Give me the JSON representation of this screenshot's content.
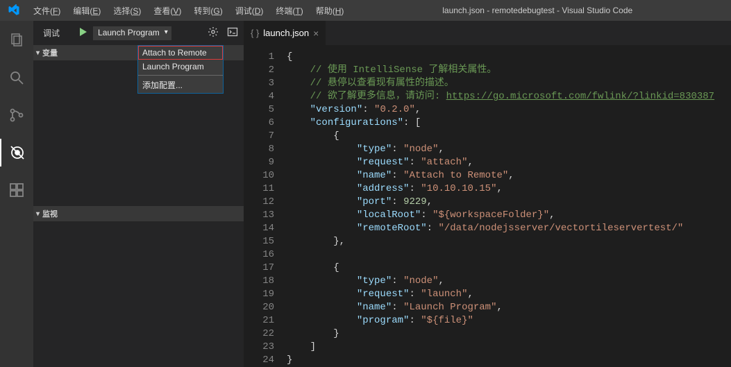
{
  "titlebar": {
    "menus": [
      "文件(F)",
      "编辑(E)",
      "选择(S)",
      "查看(V)",
      "转到(G)",
      "调试(D)",
      "终端(T)",
      "帮助(H)"
    ],
    "menus_underline": [
      "F",
      "E",
      "S",
      "V",
      "G",
      "D",
      "T",
      "H"
    ],
    "title": "launch.json - remotedebugtest - Visual Studio Code"
  },
  "activitybar": {
    "icons": [
      "files",
      "search",
      "source-control",
      "debug",
      "extensions"
    ],
    "active": "debug"
  },
  "sidebar": {
    "label": "调试",
    "config_selected": "Launch Program",
    "dropdown": {
      "items": [
        "Attach to Remote",
        "Launch Program"
      ],
      "add_config": "添加配置..."
    },
    "sections": {
      "variables": "变量",
      "watch": "监视"
    }
  },
  "tabs": {
    "file": "launch.json"
  },
  "code": {
    "lines": [
      {
        "n": 1,
        "segs": [
          {
            "t": "{",
            "c": "c-punct"
          }
        ]
      },
      {
        "n": 2,
        "indent": 4,
        "segs": [
          {
            "t": "// 使用 IntelliSense 了解相关属性。",
            "c": "c-comment"
          }
        ]
      },
      {
        "n": 3,
        "indent": 4,
        "segs": [
          {
            "t": "// 悬停以查看现有属性的描述。",
            "c": "c-comment"
          }
        ]
      },
      {
        "n": 4,
        "indent": 4,
        "segs": [
          {
            "t": "// 欲了解更多信息，请访问: ",
            "c": "c-comment"
          },
          {
            "t": "https://go.microsoft.com/fwlink/?linkid=830387",
            "c": "c-url"
          }
        ]
      },
      {
        "n": 5,
        "indent": 4,
        "segs": [
          {
            "t": "\"version\"",
            "c": "c-key"
          },
          {
            "t": ": ",
            "c": "c-punct"
          },
          {
            "t": "\"0.2.0\"",
            "c": "c-str"
          },
          {
            "t": ",",
            "c": "c-punct"
          }
        ]
      },
      {
        "n": 6,
        "indent": 4,
        "segs": [
          {
            "t": "\"configurations\"",
            "c": "c-key"
          },
          {
            "t": ": [",
            "c": "c-punct"
          }
        ]
      },
      {
        "n": 7,
        "indent": 8,
        "segs": [
          {
            "t": "{",
            "c": "c-punct"
          }
        ]
      },
      {
        "n": 8,
        "indent": 12,
        "segs": [
          {
            "t": "\"type\"",
            "c": "c-key"
          },
          {
            "t": ": ",
            "c": "c-punct"
          },
          {
            "t": "\"node\"",
            "c": "c-str"
          },
          {
            "t": ",",
            "c": "c-punct"
          }
        ]
      },
      {
        "n": 9,
        "indent": 12,
        "segs": [
          {
            "t": "\"request\"",
            "c": "c-key"
          },
          {
            "t": ": ",
            "c": "c-punct"
          },
          {
            "t": "\"attach\"",
            "c": "c-str"
          },
          {
            "t": ",",
            "c": "c-punct"
          }
        ]
      },
      {
        "n": 10,
        "indent": 12,
        "segs": [
          {
            "t": "\"name\"",
            "c": "c-key"
          },
          {
            "t": ": ",
            "c": "c-punct"
          },
          {
            "t": "\"Attach to Remote\"",
            "c": "c-str"
          },
          {
            "t": ",",
            "c": "c-punct"
          }
        ]
      },
      {
        "n": 11,
        "indent": 12,
        "segs": [
          {
            "t": "\"address\"",
            "c": "c-key"
          },
          {
            "t": ": ",
            "c": "c-punct"
          },
          {
            "t": "\"10.10.10.15\"",
            "c": "c-str"
          },
          {
            "t": ",",
            "c": "c-punct"
          }
        ]
      },
      {
        "n": 12,
        "indent": 12,
        "segs": [
          {
            "t": "\"port\"",
            "c": "c-key"
          },
          {
            "t": ": ",
            "c": "c-punct"
          },
          {
            "t": "9229",
            "c": "c-num"
          },
          {
            "t": ",",
            "c": "c-punct"
          }
        ]
      },
      {
        "n": 13,
        "indent": 12,
        "segs": [
          {
            "t": "\"localRoot\"",
            "c": "c-key"
          },
          {
            "t": ": ",
            "c": "c-punct"
          },
          {
            "t": "\"${workspaceFolder}\"",
            "c": "c-str"
          },
          {
            "t": ",",
            "c": "c-punct"
          }
        ]
      },
      {
        "n": 14,
        "indent": 12,
        "segs": [
          {
            "t": "\"remoteRoot\"",
            "c": "c-key"
          },
          {
            "t": ": ",
            "c": "c-punct"
          },
          {
            "t": "\"/data/nodejsserver/vectortileservertest/\"",
            "c": "c-str"
          }
        ]
      },
      {
        "n": 15,
        "indent": 8,
        "segs": [
          {
            "t": "},",
            "c": "c-punct"
          }
        ]
      },
      {
        "n": 16,
        "indent": 0,
        "segs": []
      },
      {
        "n": 17,
        "indent": 8,
        "segs": [
          {
            "t": "{",
            "c": "c-punct"
          }
        ]
      },
      {
        "n": 18,
        "indent": 12,
        "segs": [
          {
            "t": "\"type\"",
            "c": "c-key"
          },
          {
            "t": ": ",
            "c": "c-punct"
          },
          {
            "t": "\"node\"",
            "c": "c-str"
          },
          {
            "t": ",",
            "c": "c-punct"
          }
        ]
      },
      {
        "n": 19,
        "indent": 12,
        "segs": [
          {
            "t": "\"request\"",
            "c": "c-key"
          },
          {
            "t": ": ",
            "c": "c-punct"
          },
          {
            "t": "\"launch\"",
            "c": "c-str"
          },
          {
            "t": ",",
            "c": "c-punct"
          }
        ]
      },
      {
        "n": 20,
        "indent": 12,
        "segs": [
          {
            "t": "\"name\"",
            "c": "c-key"
          },
          {
            "t": ": ",
            "c": "c-punct"
          },
          {
            "t": "\"Launch Program\"",
            "c": "c-str"
          },
          {
            "t": ",",
            "c": "c-punct"
          }
        ]
      },
      {
        "n": 21,
        "indent": 12,
        "segs": [
          {
            "t": "\"program\"",
            "c": "c-key"
          },
          {
            "t": ": ",
            "c": "c-punct"
          },
          {
            "t": "\"${file}\"",
            "c": "c-str"
          }
        ]
      },
      {
        "n": 22,
        "indent": 8,
        "segs": [
          {
            "t": "}",
            "c": "c-punct"
          }
        ]
      },
      {
        "n": 23,
        "indent": 4,
        "segs": [
          {
            "t": "]",
            "c": "c-punct"
          }
        ]
      },
      {
        "n": 24,
        "indent": 0,
        "segs": [
          {
            "t": "}",
            "c": "c-punct"
          }
        ]
      }
    ]
  }
}
